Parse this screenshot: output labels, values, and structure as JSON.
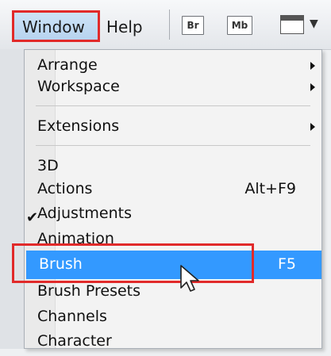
{
  "menubar": {
    "window_label": "Window",
    "help_label": "Help",
    "bridge_label": "Br",
    "minibridge_label": "Mb"
  },
  "menu": {
    "items": [
      {
        "label": "Arrange",
        "submenu": true
      },
      {
        "label": "Workspace",
        "submenu": true
      },
      {
        "label": "Extensions",
        "submenu": true
      },
      {
        "label": "3D"
      },
      {
        "label": "Actions",
        "shortcut": "Alt+F9"
      },
      {
        "label": "Adjustments",
        "checked": true
      },
      {
        "label": "Animation"
      },
      {
        "label": "Brush",
        "shortcut": "F5",
        "selected": true
      },
      {
        "label": "Brush Presets"
      },
      {
        "label": "Channels"
      },
      {
        "label": "Character"
      }
    ]
  },
  "colors": {
    "selection": "#3399ff",
    "annotation": "#e12a2a"
  }
}
